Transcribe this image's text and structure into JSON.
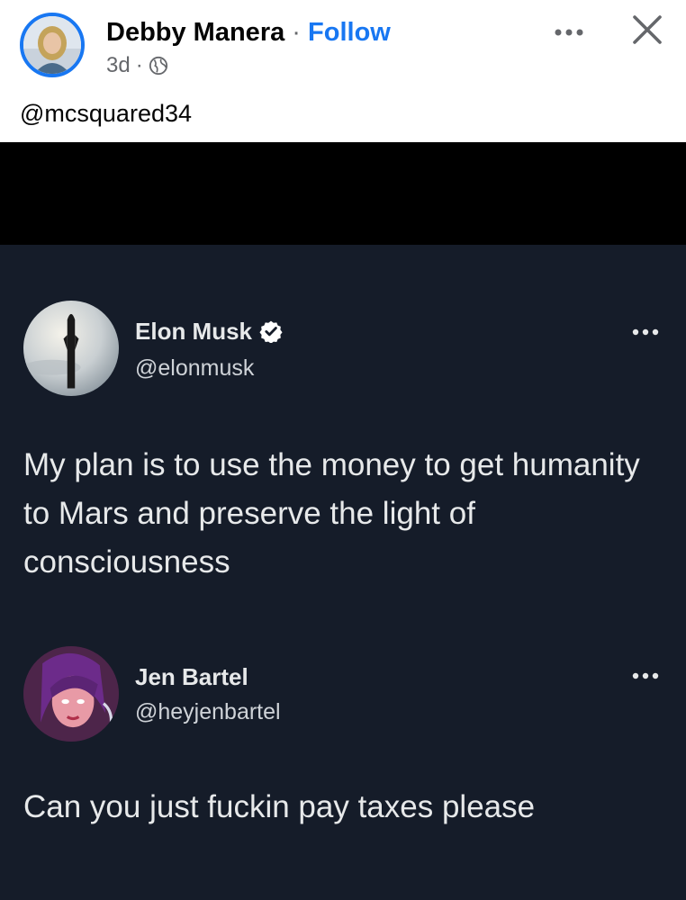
{
  "post": {
    "author": "Debby Manera",
    "separator": "·",
    "follow_label": "Follow",
    "time": "3d",
    "meta_separator": "·",
    "caption": "@mcsquared34",
    "accent_color": "#1877f2"
  },
  "tweet": {
    "name": "Elon Musk",
    "handle": "@elonmusk",
    "verified": true,
    "text": "My plan is to use the money to get humanity to Mars and preserve the light of consciousness"
  },
  "reply": {
    "name": "Jen Bartel",
    "handle": "@heyjenbartel",
    "text": "Can you just fuckin pay taxes please"
  },
  "icons": {
    "audience": "globe-icon",
    "more": "more-options-icon",
    "close": "close-icon",
    "verified": "verified-badge-icon"
  },
  "colors": {
    "screenshot_bg": "#151c29",
    "tweet_text": "#e7e9ea"
  }
}
